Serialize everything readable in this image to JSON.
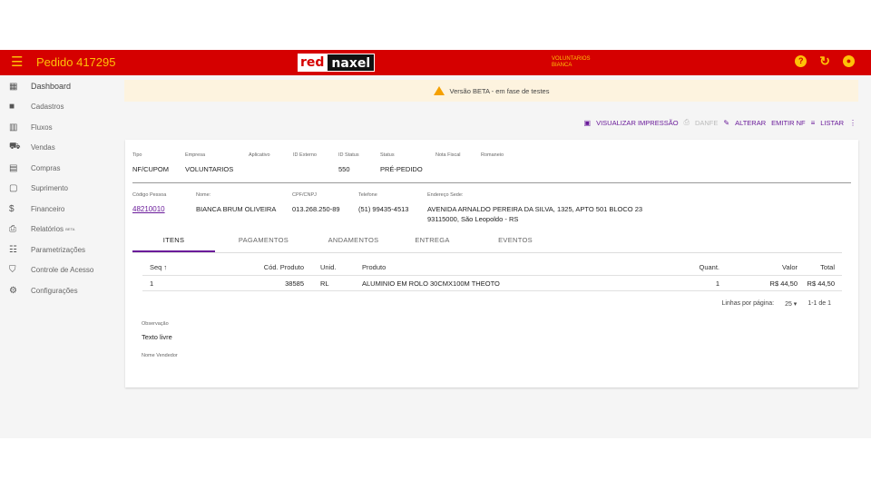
{
  "header": {
    "title": "Pedido 417295",
    "logo_left": "red",
    "logo_right": "naxel",
    "user_line1": "VOLUNTARIOS",
    "user_line2": "BIANCA"
  },
  "colors": {
    "primary": "#d50000",
    "accent": "#ffc107",
    "link": "#6a1b9a"
  },
  "sidebar": [
    {
      "label": "Dashboard",
      "icon": "dashboard-icon"
    },
    {
      "label": "Cadastros",
      "icon": "folder-icon"
    },
    {
      "label": "Fluxos",
      "icon": "columns-icon"
    },
    {
      "label": "Vendas",
      "icon": "cart-icon"
    },
    {
      "label": "Compras",
      "icon": "building-icon"
    },
    {
      "label": "Suprimento",
      "icon": "box-icon"
    },
    {
      "label": "Financeiro",
      "icon": "dollar-icon"
    },
    {
      "label": "Relatórios",
      "badge": "BETA",
      "icon": "print-icon"
    },
    {
      "label": "Parametrizações",
      "icon": "sliders-icon"
    },
    {
      "label": "Controle de Acesso",
      "icon": "shield-icon"
    },
    {
      "label": "Configurações",
      "icon": "gear-icon"
    }
  ],
  "banner": "Versão BETA - em fase de testes",
  "actions": {
    "visualizar": "VISUALIZAR IMPRESSÃO",
    "danfe": "DANFE",
    "alterar": "ALTERAR",
    "emitir": "EMITIR NF",
    "listar": "LISTAR"
  },
  "info1": {
    "tipo_label": "Tipo",
    "tipo": "NF/CUPOM",
    "empresa_label": "Empresa",
    "empresa": "VOLUNTARIOS",
    "aplicativo_label": "Aplicativo",
    "id_externo_label": "ID Externo",
    "id_status_label": "ID Status",
    "id_status": "550",
    "status_label": "Status",
    "status": "PRÉ-PEDIDO",
    "nota_label": "Nota Fiscal",
    "romaneio_label": "Romaneio"
  },
  "info2": {
    "codigo_label": "Código Pessoa",
    "codigo": "48210010",
    "nome_label": "Nome:",
    "nome": "BIANCA BRUM OLIVEIRA",
    "cpf_label": "CPF/CNPJ",
    "cpf": "013.268.250-89",
    "telefone_label": "Telefone",
    "telefone": "(51) 99435-4513",
    "endereco_label": "Endereço Sede:",
    "endereco_line1": "AVENIDA ARNALDO PEREIRA DA SILVA, 1325, APTO 501 BLOCO 23",
    "endereco_line2": "93115000, São Leopoldo - RS"
  },
  "tabs": [
    "ITENS",
    "PAGAMENTOS",
    "ANDAMENTOS",
    "ENTREGA",
    "EVENTOS"
  ],
  "table": {
    "headers": {
      "seq": "Seq ↑",
      "cod": "Cód. Produto",
      "unid": "Unid.",
      "prod": "Produto",
      "quant": "Quant.",
      "valor": "Valor",
      "total": "Total"
    },
    "rows": [
      {
        "seq": "1",
        "cod": "38585",
        "unid": "RL",
        "prod": "ALUMINIO EM ROLO 30CMX100M THEOTO",
        "quant": "1",
        "valor": "R$ 44,50",
        "total": "R$ 44,50"
      }
    ]
  },
  "pager": {
    "label": "Linhas por página:",
    "value": "25 ▾",
    "range": "1-1 de 1"
  },
  "obs": {
    "label": "Observação",
    "text": "Texto livre"
  },
  "vendedor_label": "Nome Vendedor"
}
